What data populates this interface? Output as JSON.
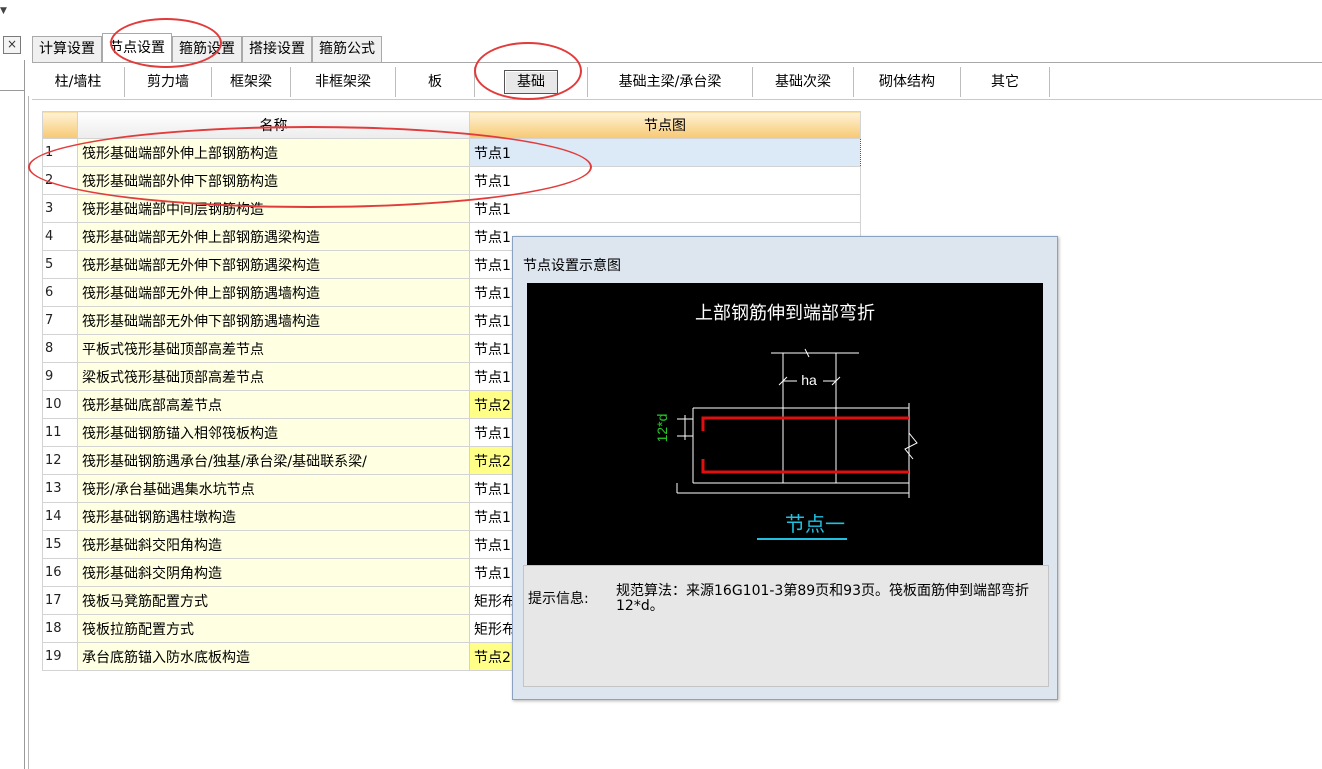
{
  "tabs_primary": [
    {
      "label": "计算设置"
    },
    {
      "label": "节点设置"
    },
    {
      "label": "箍筋设置"
    },
    {
      "label": "搭接设置"
    },
    {
      "label": "箍筋公式"
    }
  ],
  "tabs_secondary": [
    {
      "label": "柱/墙柱"
    },
    {
      "label": "剪力墙"
    },
    {
      "label": "框架梁"
    },
    {
      "label": "非框架梁"
    },
    {
      "label": "板"
    },
    {
      "label": "基础"
    },
    {
      "label": "基础主梁/承台梁"
    },
    {
      "label": "基础次梁"
    },
    {
      "label": "砌体结构"
    },
    {
      "label": "其它"
    }
  ],
  "close_glyph": "×",
  "table": {
    "headers": {
      "name": "名称",
      "value": "节点图"
    },
    "rows": [
      {
        "num": "1",
        "name": "筏形基础端部外伸上部钢筋构造",
        "value": "节点1"
      },
      {
        "num": "2",
        "name": "筏形基础端部外伸下部钢筋构造",
        "value": "节点1"
      },
      {
        "num": "3",
        "name": "筏形基础端部中间层钢筋构造",
        "value": "节点1"
      },
      {
        "num": "4",
        "name": "筏形基础端部无外伸上部钢筋遇梁构造",
        "value": "节点1"
      },
      {
        "num": "5",
        "name": "筏形基础端部无外伸下部钢筋遇梁构造",
        "value": "节点1"
      },
      {
        "num": "6",
        "name": "筏形基础端部无外伸上部钢筋遇墙构造",
        "value": "节点1"
      },
      {
        "num": "7",
        "name": "筏形基础端部无外伸下部钢筋遇墙构造",
        "value": "节点1"
      },
      {
        "num": "8",
        "name": "平板式筏形基础顶部高差节点",
        "value": "节点1"
      },
      {
        "num": "9",
        "name": "梁板式筏形基础顶部高差节点",
        "value": "节点1"
      },
      {
        "num": "10",
        "name": "筏形基础底部高差节点",
        "value": "节点2"
      },
      {
        "num": "11",
        "name": "筏形基础钢筋锚入相邻筏板构造",
        "value": "节点1"
      },
      {
        "num": "12",
        "name": "筏形基础钢筋遇承台/独基/承台梁/基础联系梁/",
        "value": "节点2"
      },
      {
        "num": "13",
        "name": "筏形/承台基础遇集水坑节点",
        "value": "节点1"
      },
      {
        "num": "14",
        "name": "筏形基础钢筋遇柱墩构造",
        "value": "节点1"
      },
      {
        "num": "15",
        "name": "筏形基础斜交阳角构造",
        "value": "节点1"
      },
      {
        "num": "16",
        "name": "筏形基础斜交阴角构造",
        "value": "节点1"
      },
      {
        "num": "17",
        "name": "筏板马凳筋配置方式",
        "value": "矩形布"
      },
      {
        "num": "18",
        "name": "筏板拉筋配置方式",
        "value": "矩形布"
      },
      {
        "num": "19",
        "name": "承台底筋锚入防水底板构造",
        "value": "节点2"
      }
    ]
  },
  "popup": {
    "title": "节点设置示意图",
    "diagram_title": "上部钢筋伸到端部弯折",
    "dim_ha": "ha",
    "dim_12d": "12*d",
    "diagram_caption": "节点一",
    "info_label": "提示信息:",
    "info_text": "规范算法：来源16G101-3第89页和93页。筏板面筋伸到端部弯折12*d。"
  },
  "colors": {
    "rebar": "#e01010",
    "dim_green": "#22cc22",
    "caption_cyan": "#21c0e0",
    "annotation": "#e23b3b"
  }
}
